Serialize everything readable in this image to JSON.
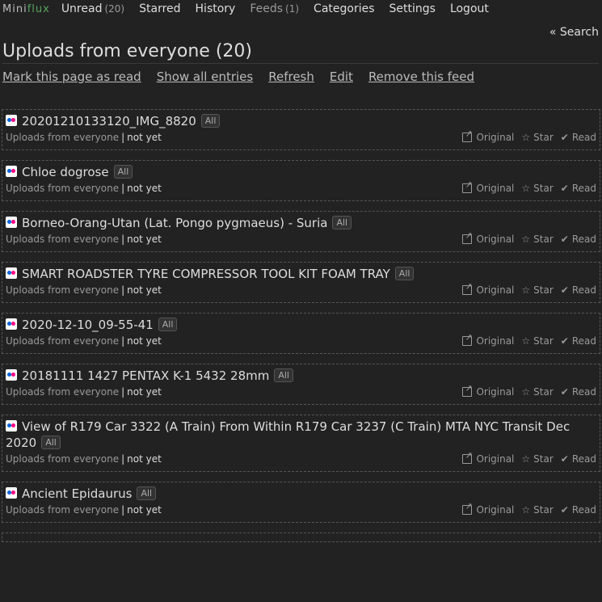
{
  "logo": {
    "part1": "Mini",
    "part2": "flux"
  },
  "nav": {
    "unread_label": "Unread",
    "unread_count": "(20)",
    "starred_label": "Starred",
    "history_label": "History",
    "feeds_label": "Feeds",
    "feeds_count": "(1)",
    "categories_label": "Categories",
    "settings_label": "Settings",
    "logout_label": "Logout"
  },
  "search_label": "« Search",
  "page_title": "Uploads from everyone (20)",
  "actions": {
    "mark_read": "Mark this page as read",
    "show_all": "Show all entries",
    "refresh": "Refresh",
    "edit": "Edit",
    "remove": "Remove this feed"
  },
  "entry_labels": {
    "feed": "Uploads from everyone",
    "sep": "|",
    "time": "not yet",
    "original": "Original",
    "star": "Star",
    "read": "Read",
    "category": "All"
  },
  "icons": {
    "favicon": "flickr-icon",
    "original": "external-link-icon",
    "star": "star-icon",
    "read": "check-icon"
  },
  "colors": {
    "background": "#222222",
    "accent": "#58a55c",
    "border": "#555555"
  },
  "entries": [
    {
      "title": "20201210133120_IMG_8820"
    },
    {
      "title": "Chloe dogrose"
    },
    {
      "title": "Borneo-Orang-Utan (Lat. Pongo pygmaeus) - Suria"
    },
    {
      "title": "SMART ROADSTER TYRE COMPRESSOR TOOL KIT FOAM TRAY"
    },
    {
      "title": "2020-12-10_09-55-41"
    },
    {
      "title": "20181111 1427 PENTAX K-1 5432 28mm"
    },
    {
      "title": "View of R179 Car 3322 (A Train) From Within R179 Car 3237 (C Train) MTA NYC Transit Dec 2020"
    },
    {
      "title": "Ancient Epidaurus"
    }
  ]
}
